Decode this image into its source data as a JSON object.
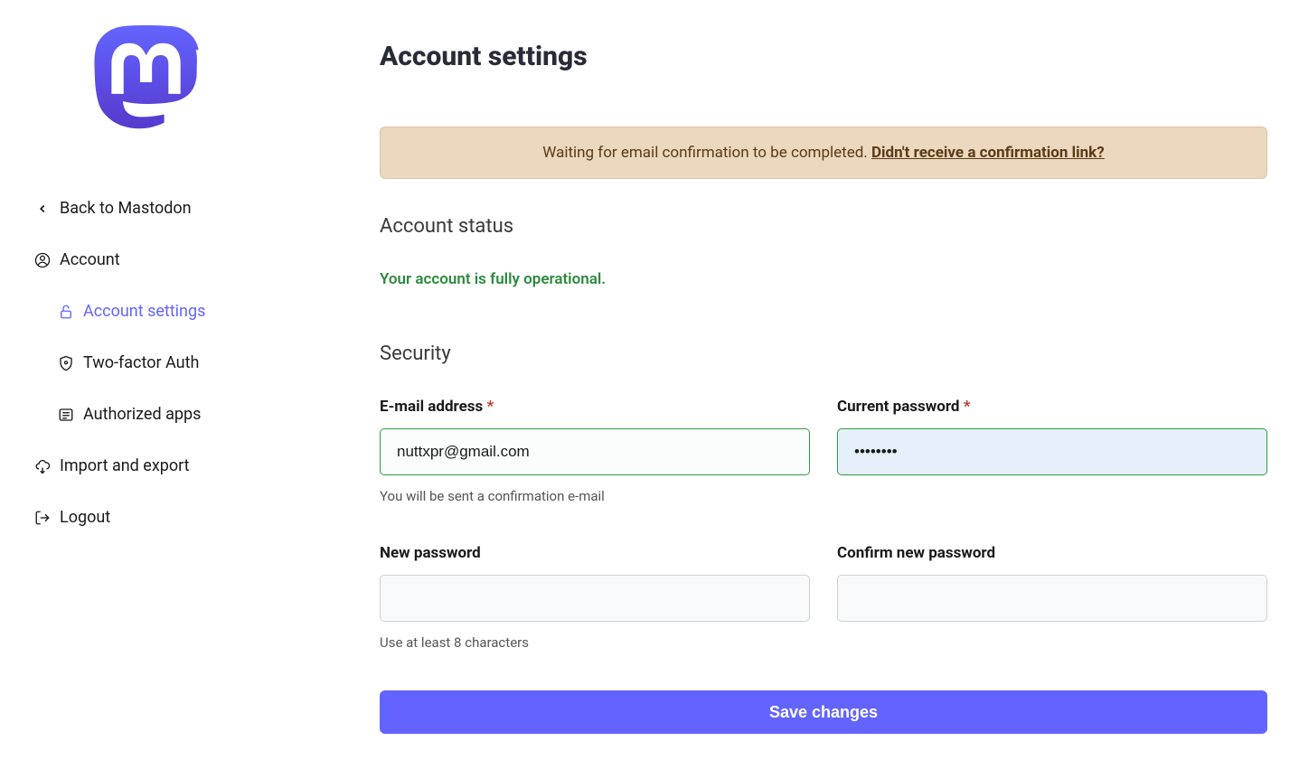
{
  "sidebar": {
    "back": "Back to Mastodon",
    "account": "Account",
    "account_settings": "Account settings",
    "two_factor": "Two-factor Auth",
    "authorized_apps": "Authorized apps",
    "import_export": "Import and export",
    "logout": "Logout"
  },
  "page": {
    "title": "Account settings"
  },
  "flash": {
    "message": "Waiting for email confirmation to be completed. ",
    "link": "Didn't receive a confirmation link?"
  },
  "status": {
    "heading": "Account status",
    "text": "Your account is fully operational."
  },
  "security": {
    "heading": "Security",
    "email_label": "E-mail address",
    "email_value": "nuttxpr@gmail.com",
    "email_hint": "You will be sent a confirmation e-mail",
    "current_password_label": "Current password",
    "current_password_value": "••••••••",
    "new_password_label": "New password",
    "new_password_hint": "Use at least 8 characters",
    "confirm_password_label": "Confirm new password",
    "save_button": "Save changes"
  }
}
